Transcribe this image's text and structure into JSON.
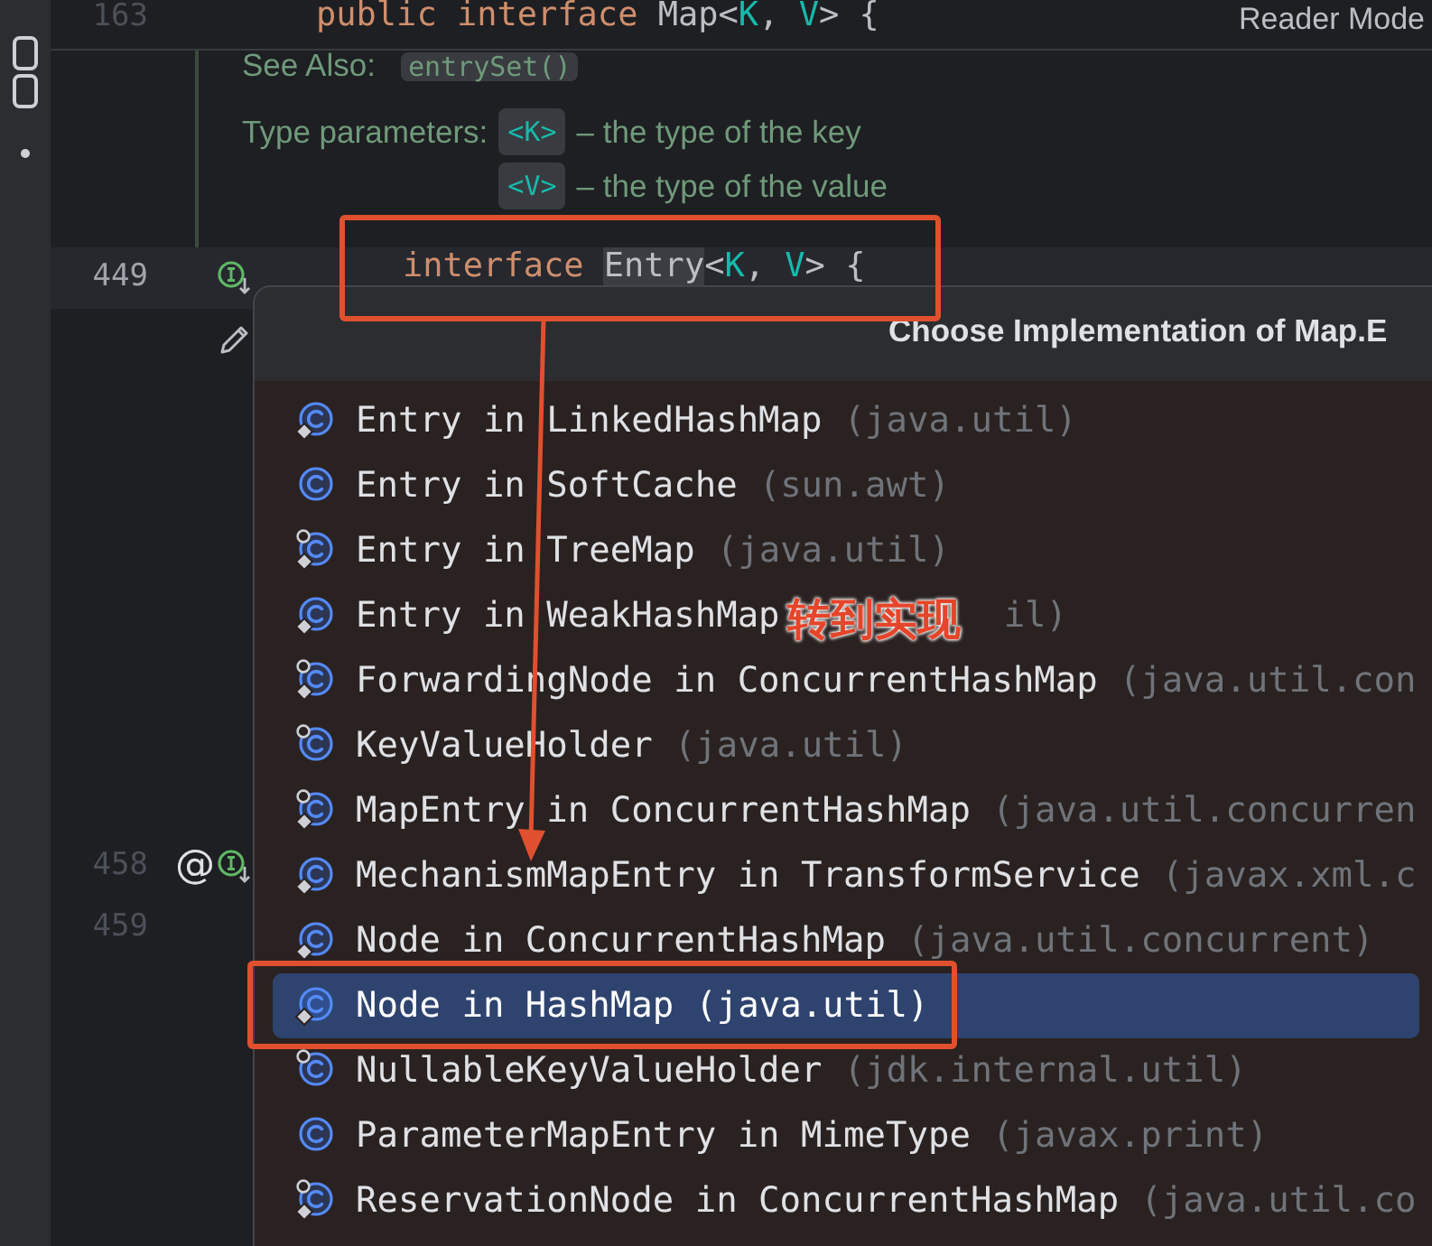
{
  "editor": {
    "reader_mode": "Reader Mode",
    "sticky_line": {
      "number": "163",
      "code": [
        {
          "text": "public interface ",
          "kind": "keyword"
        },
        {
          "text": "Map<",
          "kind": "plain"
        },
        {
          "text": "K",
          "kind": "type_param"
        },
        {
          "text": ", ",
          "kind": "plain"
        },
        {
          "text": "V",
          "kind": "type_param"
        },
        {
          "text": "> {",
          "kind": "plain"
        }
      ]
    },
    "doc": {
      "see_also_label": "See Also:",
      "see_also_link": "entrySet()",
      "type_params_label": "Type parameters:",
      "params": [
        {
          "name": "<K>",
          "description": "– the type of the key"
        },
        {
          "name": "<V>",
          "description": "– the type of the value"
        }
      ]
    },
    "lines": [
      {
        "number": "449",
        "current": true,
        "markers": [
          {
            "kind": "implemented"
          }
        ],
        "code": [
          {
            "text": "interface ",
            "kind": "keyword"
          },
          {
            "text": "Entry",
            "kind": "highlighted"
          },
          {
            "text": "<",
            "kind": "plain"
          },
          {
            "text": "K",
            "kind": "type_param"
          },
          {
            "text": ", ",
            "kind": "plain"
          },
          {
            "text": "V",
            "kind": "type_param"
          },
          {
            "text": "> {",
            "kind": "plain"
          }
        ]
      },
      {
        "current": false,
        "markers": [
          {
            "kind": "edit"
          }
        ]
      },
      {
        "kind": "gap"
      },
      {
        "number": "458",
        "current": false,
        "markers": [
          {
            "kind": "at",
            "text": "@"
          },
          {
            "kind": "implemented"
          }
        ]
      },
      {
        "number": "459",
        "current": false
      }
    ]
  },
  "popup": {
    "title": "Choose Implementation of Map.E",
    "items": [
      {
        "kind": "class_diamond",
        "name": "Entry in LinkedHashMap",
        "package": "(java.util)",
        "selected": false
      },
      {
        "kind": "class",
        "name": "Entry in SoftCache",
        "package": "(sun.awt)",
        "selected": false
      },
      {
        "kind": "class_pin_diamond",
        "name": "Entry in TreeMap",
        "package": "(java.util)",
        "selected": false
      },
      {
        "kind": "class_diamond",
        "name": "Entry in WeakHashMap",
        "package": "il)",
        "selected": false
      },
      {
        "kind": "class_pin_diamond",
        "name": "ForwardingNode in ConcurrentHashMap",
        "package": "(java.util.con",
        "selected": false
      },
      {
        "kind": "class_pin",
        "name": "KeyValueHolder",
        "package": "(java.util)",
        "selected": false
      },
      {
        "kind": "class_pin_diamond",
        "name": "MapEntry in ConcurrentHashMap",
        "package": "(java.util.concurren",
        "selected": false
      },
      {
        "kind": "class_diamond",
        "name": "MechanismMapEntry in TransformService",
        "package": "(javax.xml.c",
        "selected": false
      },
      {
        "kind": "class_diamond",
        "name": "Node in ConcurrentHashMap",
        "package": "(java.util.concurrent)",
        "selected": false
      },
      {
        "kind": "class_diamond",
        "name": "Node in HashMap",
        "package": "(java.util)",
        "selected": true
      },
      {
        "kind": "class_pin",
        "name": "NullableKeyValueHolder",
        "package": "(jdk.internal.util)",
        "selected": false
      },
      {
        "kind": "class",
        "name": "ParameterMapEntry in MimeType",
        "package": "(javax.print)",
        "selected": false
      },
      {
        "kind": "class_pin_diamond",
        "name": "ReservationNode in ConcurrentHashMap",
        "package": "(java.util.co",
        "selected": false
      }
    ]
  },
  "annotation": {
    "label": "转到实现"
  }
}
